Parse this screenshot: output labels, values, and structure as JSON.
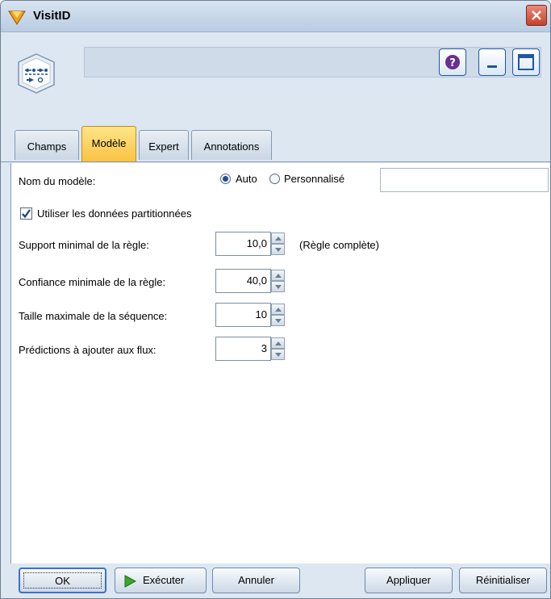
{
  "window": {
    "title": "VisitID"
  },
  "tabs": [
    {
      "label": "Champs"
    },
    {
      "label": "Modèle"
    },
    {
      "label": "Expert"
    },
    {
      "label": "Annotations"
    }
  ],
  "form": {
    "model_name_label": "Nom du modèle:",
    "radio_auto_label": "Auto",
    "radio_custom_label": "Personnalisé",
    "custom_name_value": "",
    "use_partitioned_label": "Utiliser les données partitionnées",
    "min_support_label": "Support minimal de la règle:",
    "min_support_value": "10,0",
    "min_support_note": "(Règle complète)",
    "min_confidence_label": "Confiance minimale de la règle:",
    "min_confidence_value": "40,0",
    "max_seq_size_label": "Taille maximale de la séquence:",
    "max_seq_size_value": "10",
    "predictions_label": "Prédictions à ajouter aux flux:",
    "predictions_value": "3"
  },
  "buttons": {
    "ok": "OK",
    "run": "Exécuter",
    "cancel": "Annuler",
    "apply": "Appliquer",
    "reset": "Réinitialiser"
  },
  "colors": {
    "active_tab": "#f9c240",
    "accent": "#1e56a8",
    "close": "#c5412b"
  }
}
